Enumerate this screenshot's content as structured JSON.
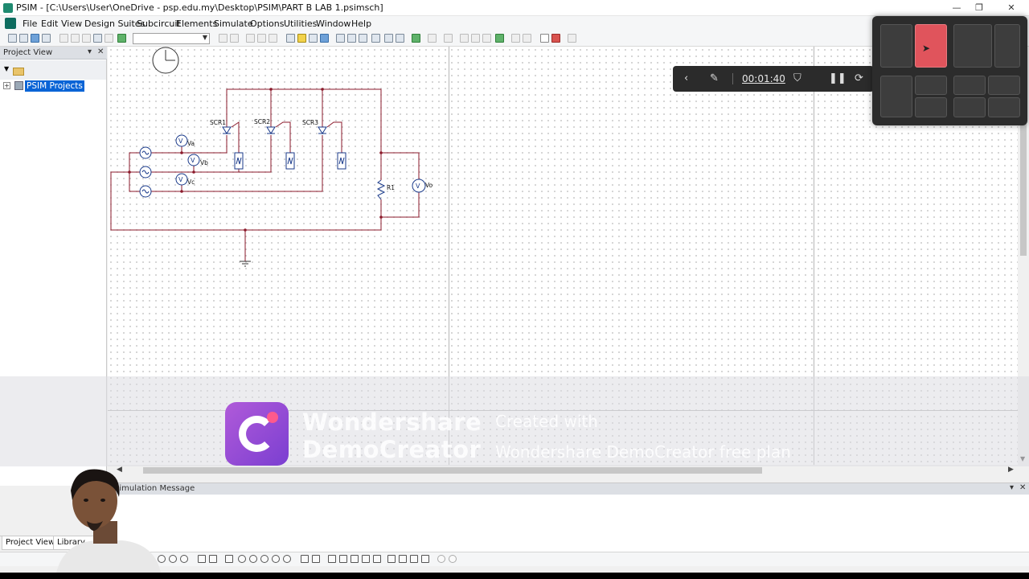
{
  "window": {
    "title": "PSIM - [C:\\Users\\User\\OneDrive - psp.edu.my\\Desktop\\PSIM\\PART B LAB 1.psimsch]"
  },
  "menu": [
    "File",
    "Edit",
    "View",
    "Design Suites",
    "Subcircuit",
    "Elements",
    "Simulate",
    "Options",
    "Utilities",
    "Window",
    "Help"
  ],
  "project_panel": {
    "title": "Project View",
    "tree_root": "PSIM Projects"
  },
  "schematic": {
    "labels": {
      "scr1": "SCR1",
      "scr2": "SCR2",
      "scr3": "SCR3",
      "va": "Va",
      "vb": "Vb",
      "vc": "Vc",
      "r1": "R1",
      "vo": "Vo"
    }
  },
  "recorder": {
    "timer": "00:01:40"
  },
  "sim_panel": {
    "title": "Simulation Message"
  },
  "bottom_tabs": [
    "Project View",
    "Library"
  ],
  "watermark": {
    "brand_line1": "Wondershare",
    "brand_line2": "DemoCreator",
    "created_line1": "Created with",
    "created_line2": "Wondershare DemoCreator free plan"
  },
  "icons": {
    "clock": "clock-icon",
    "folder": "folder-icon",
    "ground": "ground-icon"
  },
  "colors": {
    "wire": "#8b1a2b",
    "selection": "#0a64d6",
    "snap_highlight": "#e0545c",
    "recorder_bg": "#2b2b2b"
  }
}
